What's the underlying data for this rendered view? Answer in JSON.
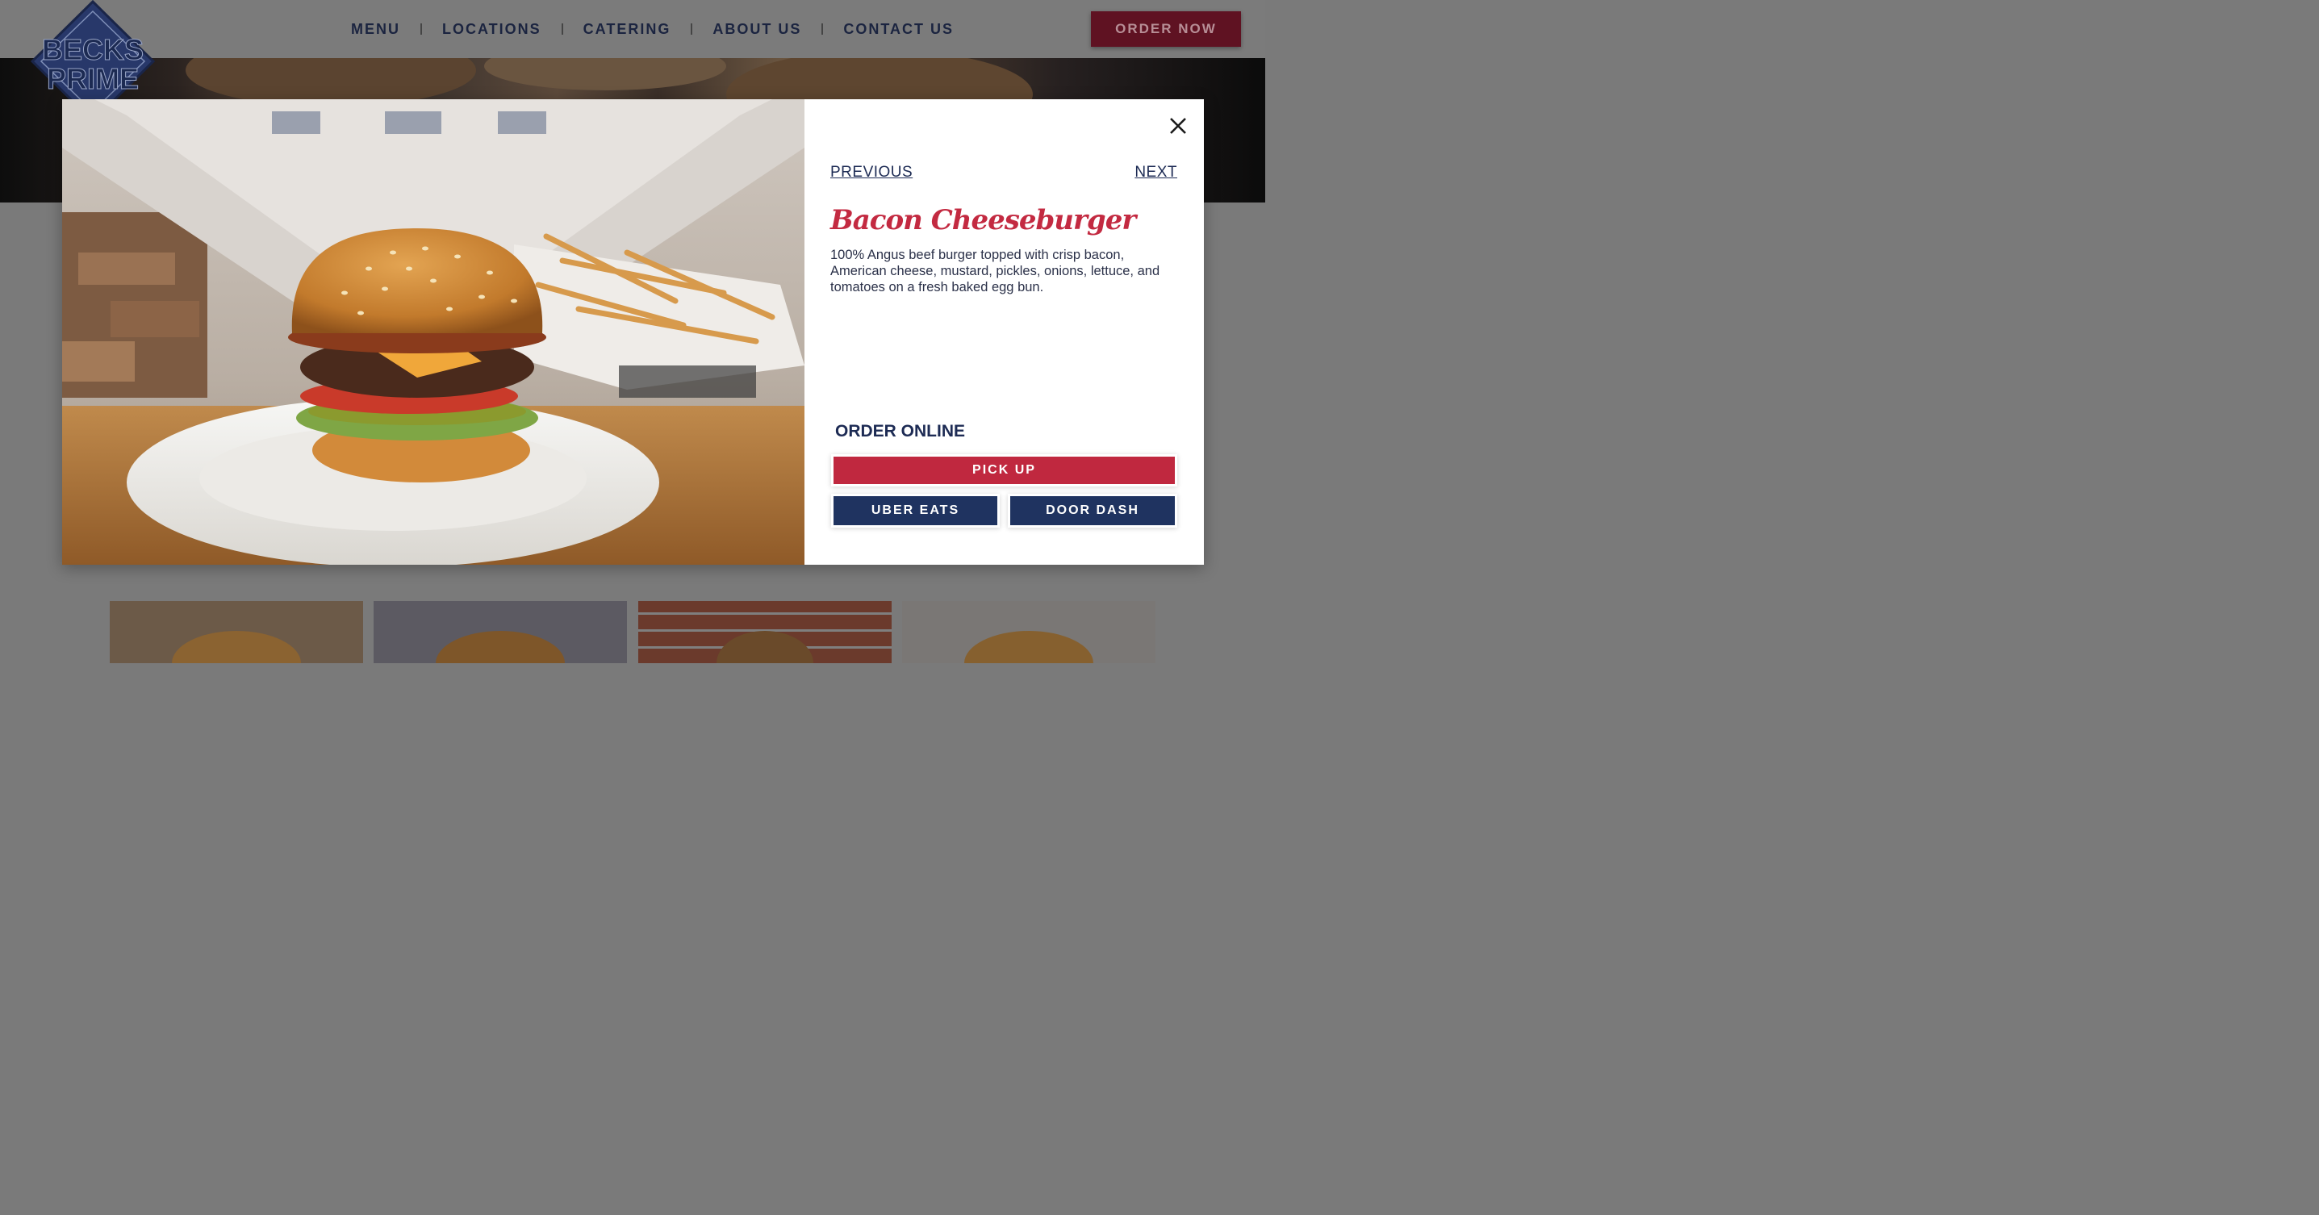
{
  "header": {
    "logo_text_line1": "BECKS",
    "logo_text_line2": "PRIME",
    "nav": [
      {
        "label": "MENU"
      },
      {
        "label": "LOCATIONS"
      },
      {
        "label": "CATERING"
      },
      {
        "label": "ABOUT US"
      },
      {
        "label": "CONTACT US"
      }
    ],
    "order_now_label": "ORDER NOW"
  },
  "modal": {
    "close_label": "X",
    "previous_label": "PREVIOUS",
    "next_label": "NEXT",
    "item": {
      "title": "Bacon Cheeseburger",
      "description": "100% Angus beef burger topped with crisp bacon, American cheese, mustard, pickles, onions, lettuce, and tomatoes on a fresh baked egg bun."
    },
    "order_online_heading": "ORDER ONLINE",
    "buttons": {
      "pickup": "PICK UP",
      "uber_eats": "UBER EATS",
      "door_dash": "DOOR DASH"
    }
  },
  "colors": {
    "brand_red": "#c0283f",
    "brand_navy": "#1f3360",
    "title_red": "#c32a41",
    "overlay_gray": "#7a7a7a"
  },
  "icons": [
    "close-icon",
    "becks-prime-logo"
  ]
}
